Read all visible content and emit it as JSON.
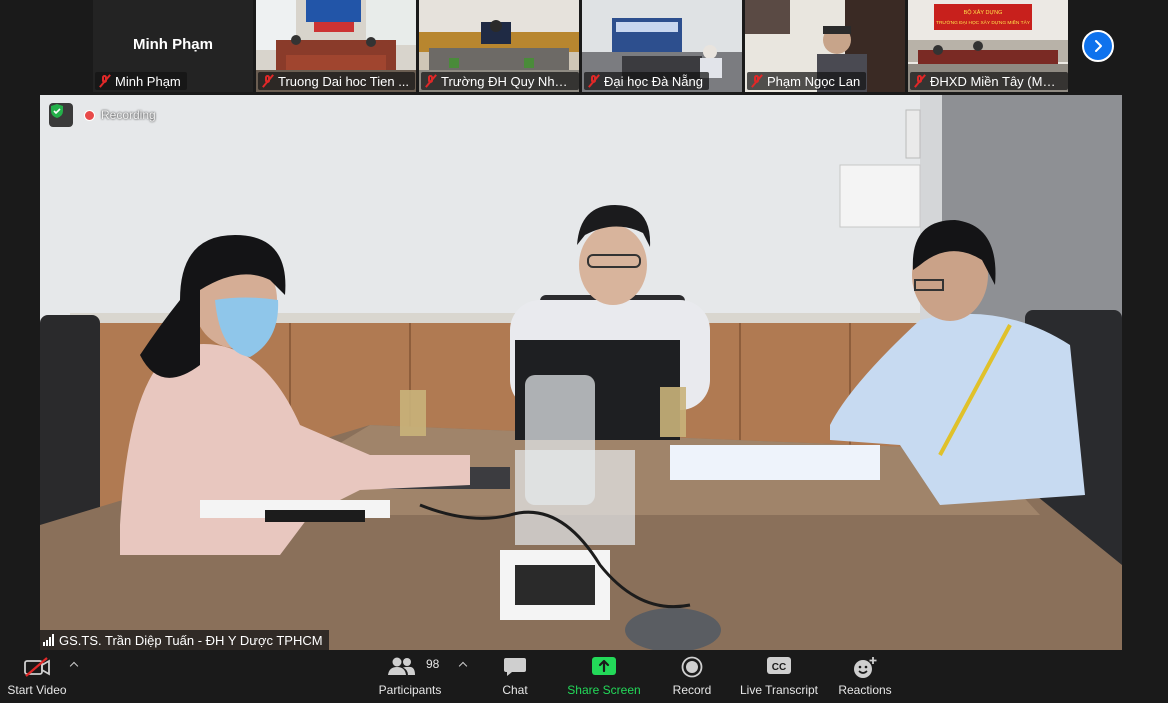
{
  "thumbnails": [
    {
      "name": "Minh Phạm",
      "card_name": "Minh Phạm",
      "type": "namecard"
    },
    {
      "name": "Truong Dai hoc Tien ...",
      "type": "video"
    },
    {
      "name": "Trường ĐH Quy Nhơn –",
      "type": "video"
    },
    {
      "name": "Đại học Đà Nẵng",
      "type": "video"
    },
    {
      "name": "Phạm Ngọc Lan",
      "type": "video"
    },
    {
      "name": "ĐHXD Miền Tây (MTU)",
      "type": "video"
    }
  ],
  "main_video": {
    "recording_label": "Recording",
    "active_speaker": "GS.TS. Trần Diệp Tuấn - ĐH Y Dược TPHCM",
    "sign_text": {
      "line1": "BỘ XÂY DỰNG",
      "line2": "TRƯỜNG ĐẠI HỌC XÂY DỰNG MIỀN TÂY"
    }
  },
  "toolbar": {
    "start_video": "Start Video",
    "participants": "Participants",
    "participants_count": "98",
    "chat": "Chat",
    "share_screen": "Share Screen",
    "record": "Record",
    "live_transcript": "Live Transcript",
    "cc_badge": "CC",
    "reactions": "Reactions"
  },
  "colors": {
    "accent_blue": "#0e72ed",
    "share_green": "#23d959",
    "muted_red": "#e02828",
    "recording_red": "#e84a4a"
  }
}
